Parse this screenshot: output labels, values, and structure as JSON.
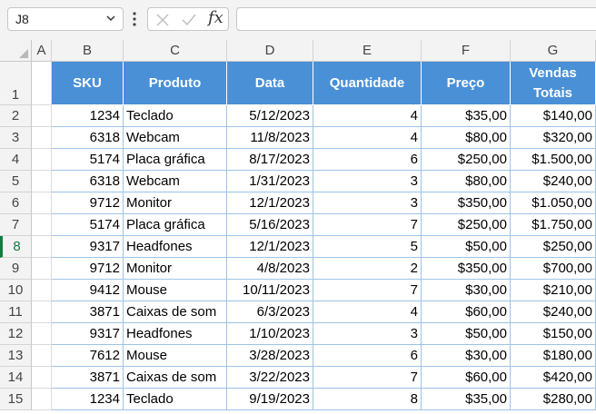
{
  "formula_bar": {
    "name_box": "J8",
    "fx_label": "fx",
    "formula": ""
  },
  "columns": [
    "A",
    "B",
    "C",
    "D",
    "E",
    "F",
    "G"
  ],
  "rows": [
    "1",
    "2",
    "3",
    "4",
    "5",
    "6",
    "7",
    "8",
    "9",
    "10",
    "11",
    "12",
    "13",
    "14",
    "15"
  ],
  "selected_row": "8",
  "table": {
    "headers": [
      "SKU",
      "Produto",
      "Data",
      "Quantidade",
      "Preço",
      "Vendas Totais"
    ],
    "rows": [
      [
        "1234",
        "Teclado",
        "5/12/2023",
        "4",
        "$35,00",
        "$140,00"
      ],
      [
        "6318",
        "Webcam",
        "11/8/2023",
        "4",
        "$80,00",
        "$320,00"
      ],
      [
        "5174",
        "Placa gráfica",
        "8/17/2023",
        "6",
        "$250,00",
        "$1.500,00"
      ],
      [
        "6318",
        "Webcam",
        "1/31/2023",
        "3",
        "$80,00",
        "$240,00"
      ],
      [
        "9712",
        "Monitor",
        "12/1/2023",
        "3",
        "$350,00",
        "$1.050,00"
      ],
      [
        "5174",
        "Placa gráfica",
        "5/16/2023",
        "7",
        "$250,00",
        "$1.750,00"
      ],
      [
        "9317",
        "Headfones",
        "12/1/2023",
        "5",
        "$50,00",
        "$250,00"
      ],
      [
        "9712",
        "Monitor",
        "4/8/2023",
        "2",
        "$350,00",
        "$700,00"
      ],
      [
        "9412",
        "Mouse",
        "10/11/2023",
        "7",
        "$30,00",
        "$210,00"
      ],
      [
        "3871",
        "Caixas de som",
        "6/3/2023",
        "4",
        "$60,00",
        "$240,00"
      ],
      [
        "9317",
        "Headfones",
        "1/10/2023",
        "3",
        "$50,00",
        "$150,00"
      ],
      [
        "7612",
        "Mouse",
        "3/28/2023",
        "6",
        "$30,00",
        "$180,00"
      ],
      [
        "3871",
        "Caixas de som",
        "3/22/2023",
        "7",
        "$60,00",
        "$420,00"
      ],
      [
        "1234",
        "Teclado",
        "9/19/2023",
        "8",
        "$35,00",
        "$280,00"
      ]
    ]
  },
  "colors": {
    "header_fill": "#4a90d6",
    "header_text": "#ffffff",
    "selected_row_accent": "#107c41"
  }
}
